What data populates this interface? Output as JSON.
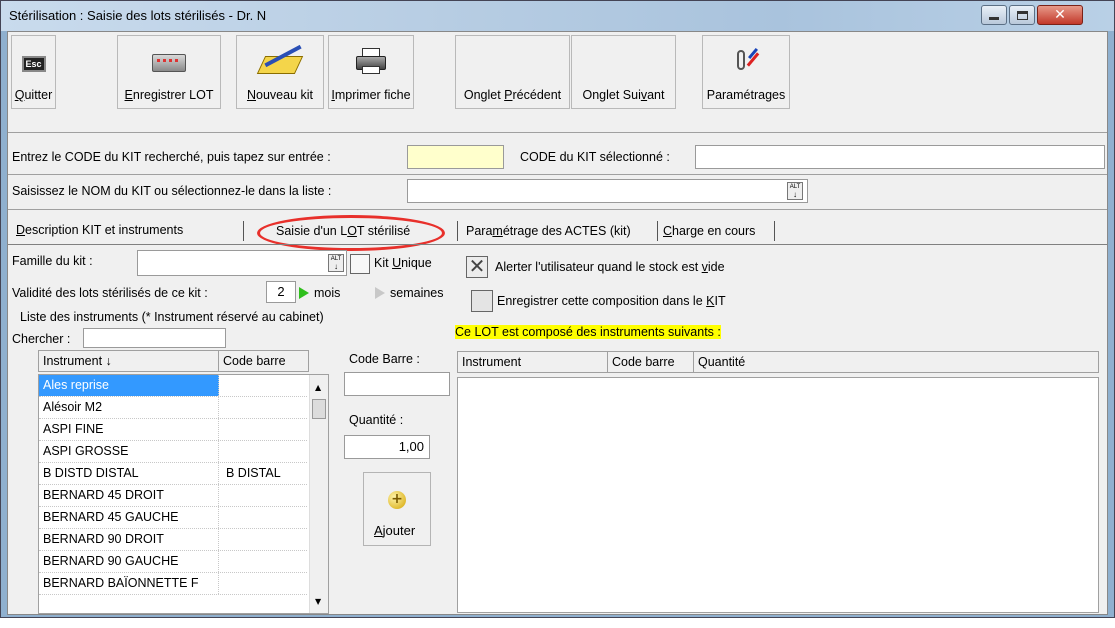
{
  "window": {
    "title": "Stérilisation : Saisie des lots stérilisés - Dr. N"
  },
  "toolbar": {
    "quit": {
      "pre": "",
      "key": "Q",
      "post": "uitter",
      "icon": "esc-key-icon"
    },
    "save_lot": {
      "pre": "",
      "key": "E",
      "post": "nregistrer LOT",
      "icon": "keyboard-icon"
    },
    "new_kit": {
      "pre": "",
      "key": "N",
      "post": "ouveau kit",
      "icon": "notepad-pencil-icon"
    },
    "print": {
      "pre": "",
      "key": "I",
      "post": "mprimer fiche",
      "icon": "printer-icon"
    },
    "prev_tab": {
      "pre": "Onglet ",
      "key": "P",
      "post": "récédent"
    },
    "next_tab": {
      "pre": "Onglet Sui",
      "key": "v",
      "post": "ant"
    },
    "settings": {
      "pre": "Paramétra",
      "key": "g",
      "post": "es",
      "icon": "tools-icon"
    }
  },
  "search": {
    "code_label": "Entrez le CODE du KIT recherché, puis tapez sur entrée :",
    "code_value": "",
    "selected_code_label": "CODE du KIT sélectionné :",
    "selected_code_value": "",
    "name_label": "Saisissez le NOM du KIT ou sélectionnez-le dans la liste :",
    "name_value": "",
    "alt_label": "ALT"
  },
  "tabs": {
    "desc": {
      "pre": "",
      "key": "D",
      "post": "escription KIT et instruments"
    },
    "lot": {
      "pre": "Saisie d'un L",
      "key": "O",
      "post": "T stérilisé"
    },
    "actes": {
      "pre": "Para",
      "key": "m",
      "post": "étrage des ACTES (kit)"
    },
    "charge": {
      "pre": "",
      "key": "C",
      "post": "harge en cours"
    }
  },
  "kit": {
    "family_label": "Famille du kit :",
    "family_value": "",
    "unique_pre": "Kit ",
    "unique_key": "U",
    "unique_post": "nique",
    "alert_pre": "Alerter l'utilisateur quand le stock est ",
    "alert_key": "v",
    "alert_post": "ide",
    "alert_checked": true,
    "validity_label": "Validité des lots stérilisés de ce kit :",
    "validity_value": "2",
    "unit_months": "mois",
    "unit_weeks": "semaines",
    "save_comp_pre": "Enregistrer cette composition dans le ",
    "save_comp_key": "K",
    "save_comp_post": "IT",
    "instruments_label": "Liste des instruments (* Instrument réservé au cabinet)",
    "search_label": "Chercher :",
    "search_value": ""
  },
  "instrument_list": {
    "col_instrument": "Instrument",
    "col_barcode": "Code barre",
    "sort_arrow": "↓",
    "rows": [
      {
        "name": "Ales reprise",
        "code": ""
      },
      {
        "name": "Alésoir M2",
        "code": ""
      },
      {
        "name": "ASPI FINE",
        "code": ""
      },
      {
        "name": "ASPI GROSSE",
        "code": ""
      },
      {
        "name": "B DISTD DISTAL",
        "code": "B DISTAL"
      },
      {
        "name": "BERNARD 45 DROIT",
        "code": ""
      },
      {
        "name": "BERNARD 45 GAUCHE",
        "code": ""
      },
      {
        "name": "BERNARD 90 DROIT",
        "code": ""
      },
      {
        "name": "BERNARD 90 GAUCHE",
        "code": ""
      },
      {
        "name": "BERNARD BAÏONNETTE F",
        "code": ""
      }
    ]
  },
  "entry": {
    "barcode_label": "Code Barre :",
    "barcode_value": "",
    "qty_label": "Quantité :",
    "qty_value": "1,00",
    "add_pre": "",
    "add_key": "A",
    "add_post": "jouter"
  },
  "composition": {
    "title": "Ce LOT est composé des instruments suivants :",
    "col_instrument": "Instrument",
    "col_barcode": "Code barre",
    "col_qty": "Quantité"
  },
  "colors": {
    "highlight": "#ffff00",
    "selection": "#3399ff",
    "annotation": "#e8302b",
    "code_field": "#ffffcc"
  }
}
